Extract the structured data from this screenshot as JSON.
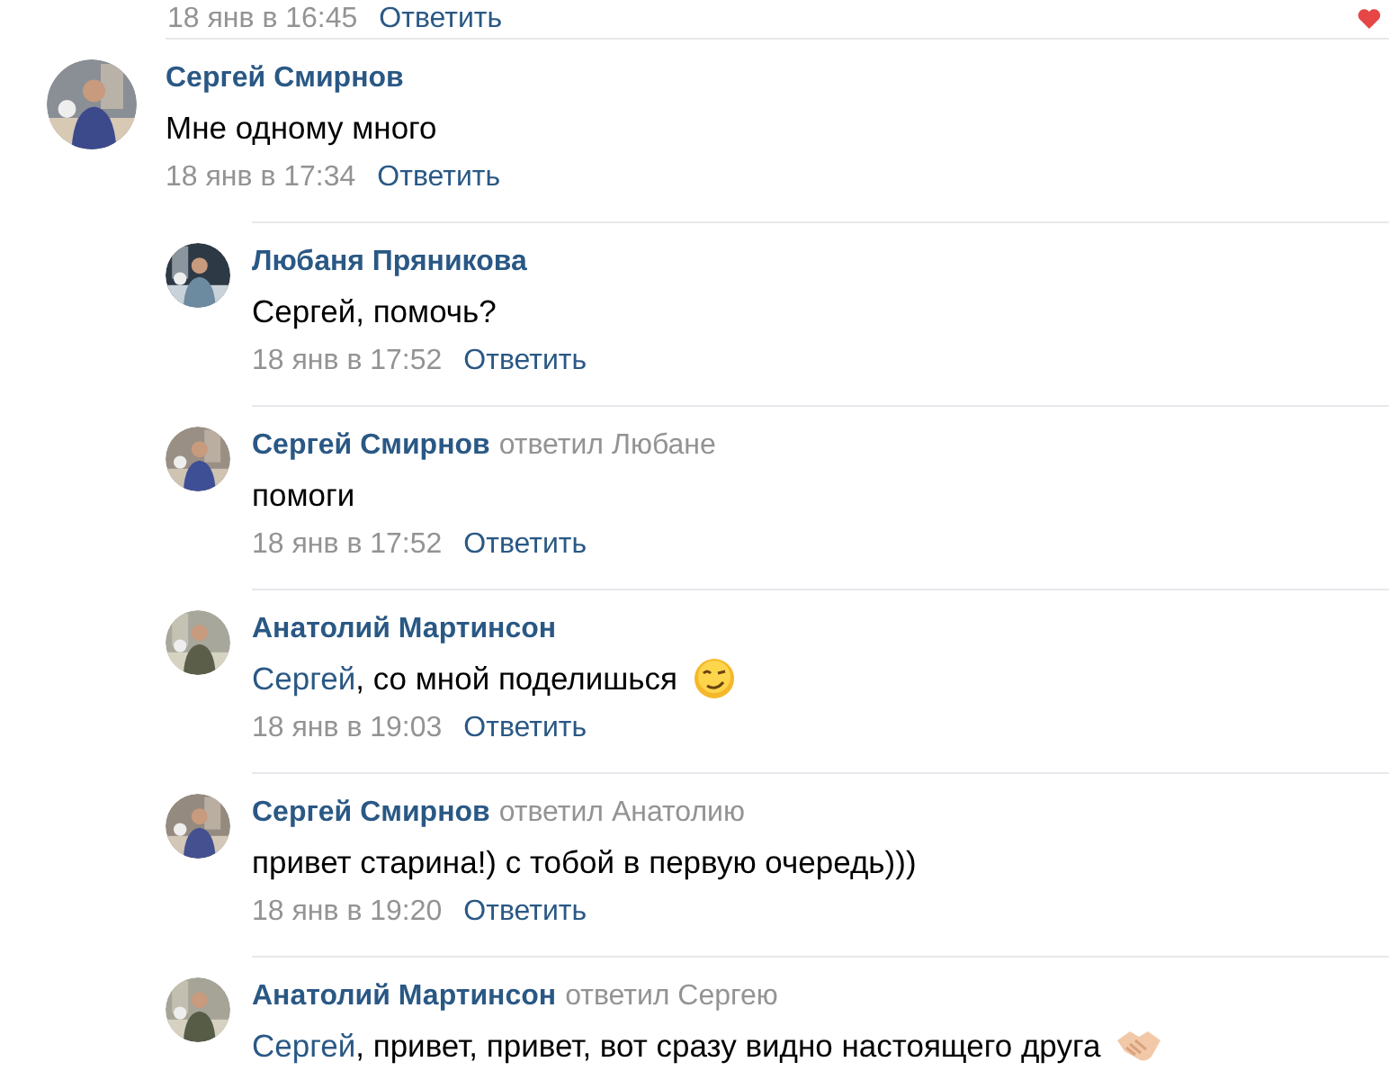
{
  "previous_comment": {
    "date": "18 янв в 16:45",
    "reply_label": "Ответить",
    "liked": true
  },
  "comment": {
    "author": "Сергей Смирнов",
    "text": [
      {
        "kind": "plain",
        "text": "Мне одному много"
      }
    ],
    "date": "18 янв в 17:34",
    "reply_label": "Ответить",
    "children": [
      {
        "author": "Любаня Пряникова",
        "text": [
          {
            "kind": "plain",
            "text": "Сергей, помочь?"
          }
        ],
        "date": "18 янв в 17:52",
        "reply_label": "Ответить"
      },
      {
        "author": "Сергей Смирнов",
        "reply_to": "ответил Любане",
        "text": [
          {
            "kind": "plain",
            "text": "помоги"
          }
        ],
        "date": "18 янв в 17:52",
        "reply_label": "Ответить"
      },
      {
        "author": "Анатолий Мартинсон",
        "text": [
          {
            "kind": "mention",
            "text": "Сергей"
          },
          {
            "kind": "plain",
            "text": ", со мной поделишься"
          },
          {
            "kind": "wink-emoji"
          }
        ],
        "date": "18 янв в 19:03",
        "reply_label": "Ответить"
      },
      {
        "author": "Сергей Смирнов",
        "reply_to": "ответил Анатолию",
        "text": [
          {
            "kind": "plain",
            "text": "привет старина!) с тобой в первую очередь)))"
          }
        ],
        "date": "18 янв в 19:20",
        "reply_label": "Ответить"
      },
      {
        "author": "Анатолий Мартинсон",
        "reply_to": "ответил Сергею",
        "text": [
          {
            "kind": "mention",
            "text": "Сергей"
          },
          {
            "kind": "plain",
            "text": ", привет, привет, вот сразу видно настоящего друга"
          },
          {
            "kind": "handshake-emoji"
          }
        ]
      }
    ]
  }
}
